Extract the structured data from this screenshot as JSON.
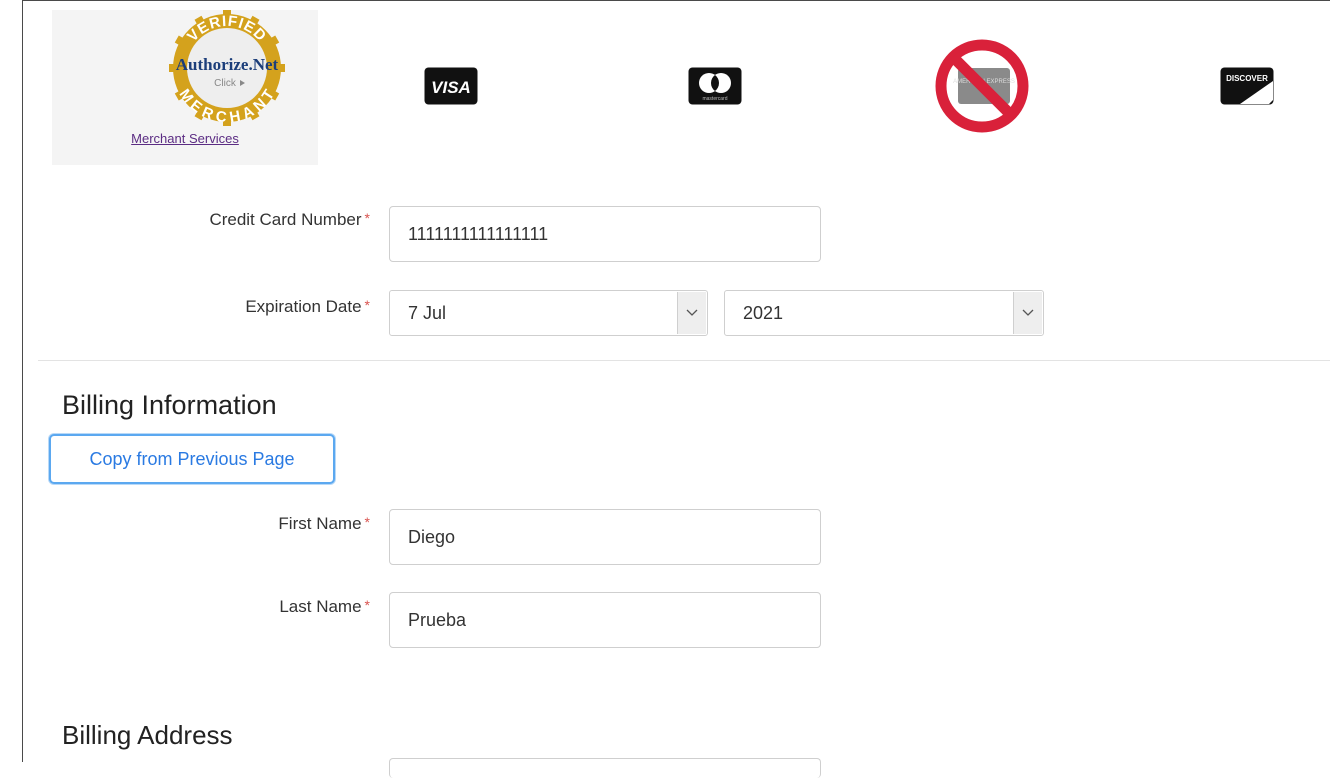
{
  "payment": {
    "seal": {
      "top_text": "VERIFIED",
      "brand": "Authorize.Net",
      "click": "Click",
      "bottom_text": "MERCHANT",
      "link_label": "Merchant Services"
    },
    "cards": [
      {
        "name": "visa",
        "label": "VISA",
        "accepted": true
      },
      {
        "name": "mastercard",
        "label": "mastercard",
        "accepted": true
      },
      {
        "name": "american-express",
        "label": "AMERICAN EXPRESS",
        "accepted": false
      },
      {
        "name": "discover",
        "label": "DISCOVER",
        "accepted": true
      }
    ],
    "card_number_label": "Credit Card Number",
    "card_number_value": "1111111111111111",
    "expiration_label": "Expiration Date",
    "exp_month": "7 Jul",
    "exp_year": "2021",
    "required_marker": "*"
  },
  "billing": {
    "heading": "Billing Information",
    "copy_button": "Copy from Previous Page",
    "first_name_label": "First Name",
    "first_name_value": "Diego",
    "last_name_label": "Last Name",
    "last_name_value": "Prueba"
  },
  "address": {
    "heading": "Billing Address"
  },
  "colors": {
    "required": "#d9534f",
    "link": "#5b2c83",
    "button_text": "#2a7ae2",
    "seal_gold": "#d4a21d",
    "seal_navy": "#1c3e7a",
    "no_sign_red": "#d9213a"
  }
}
